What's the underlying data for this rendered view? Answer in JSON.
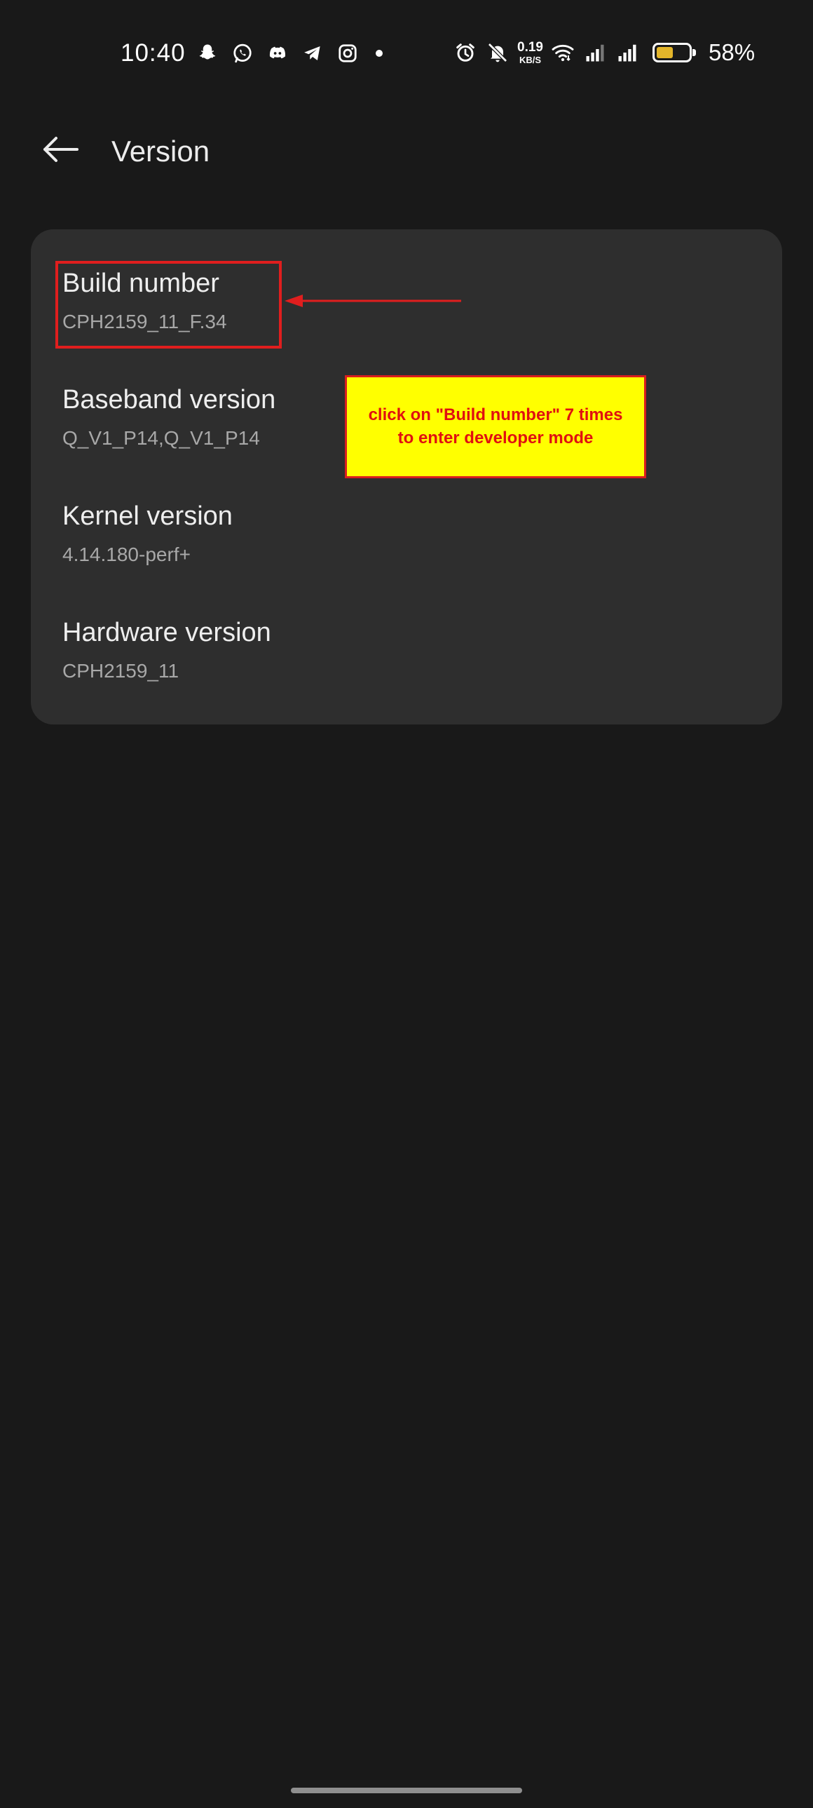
{
  "status_bar": {
    "time": "10:40",
    "left_icons": [
      "snapchat-icon",
      "whatsapp-icon",
      "discord-icon",
      "telegram-icon",
      "instagram-icon"
    ],
    "right_icons": [
      "alarm-icon",
      "mute-icon",
      "wifi-icon",
      "signal-icon",
      "signal-icon"
    ],
    "net_speed_value": "0.19",
    "net_speed_unit": "KB/S",
    "battery_percent": "58%",
    "battery_level": 0.58,
    "battery_color": "#e3b52a"
  },
  "header": {
    "back_icon": "arrow-left-icon",
    "title": "Version"
  },
  "items": [
    {
      "title": "Build number",
      "value": "CPH2159_11_F.34"
    },
    {
      "title": "Baseband version",
      "value": "Q_V1_P14,Q_V1_P14"
    },
    {
      "title": "Kernel version",
      "value": "4.14.180-perf+"
    },
    {
      "title": "Hardware version",
      "value": "CPH2159_11"
    }
  ],
  "annotation": {
    "line1": "click on \"Build number\" 7 times",
    "line2": "to enter developer mode",
    "highlight_color": "#e01e1e",
    "box_color": "#ffff00"
  }
}
